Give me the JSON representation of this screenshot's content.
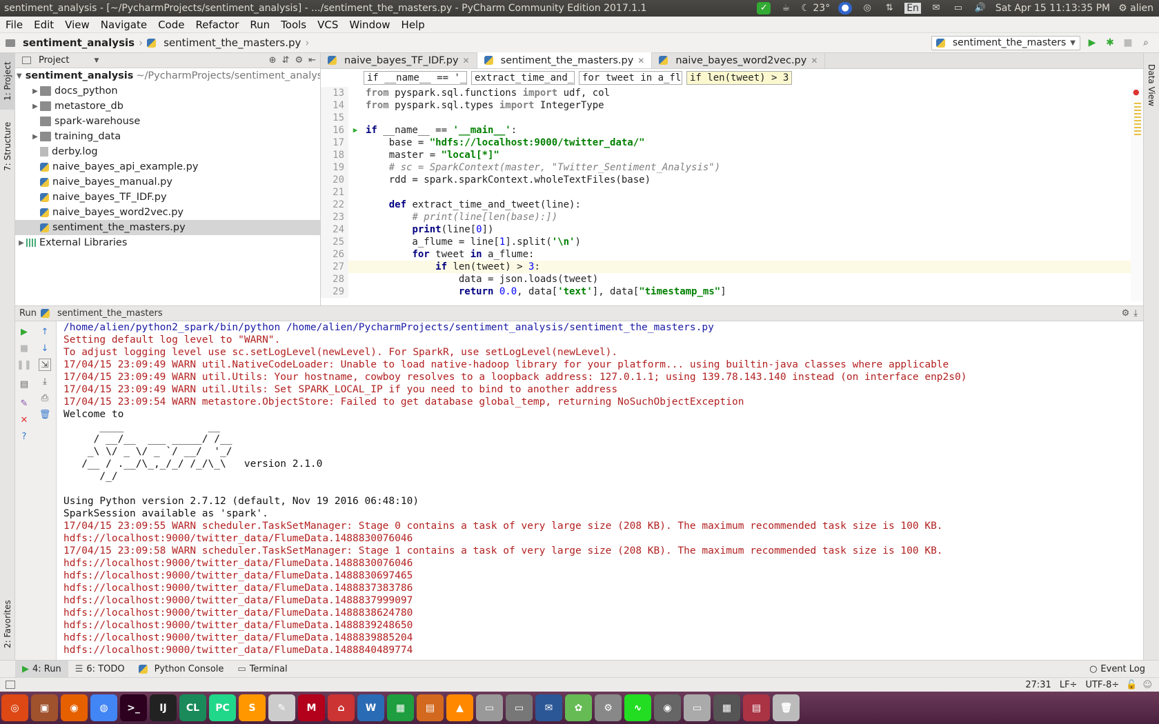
{
  "window": {
    "title": "sentiment_analysis - [~/PycharmProjects/sentiment_analysis] - .../sentiment_the_masters.py - PyCharm Community Edition 2017.1.1"
  },
  "tray": {
    "temp": "23°",
    "lang": "En",
    "datetime": "Sat Apr 15 11:13:35 PM",
    "user": "alien"
  },
  "menu": [
    "File",
    "Edit",
    "View",
    "Navigate",
    "Code",
    "Refactor",
    "Run",
    "Tools",
    "VCS",
    "Window",
    "Help"
  ],
  "breadcrumb": {
    "project": "sentiment_analysis",
    "file": "sentiment_the_masters.py"
  },
  "run_config": "sentiment_the_masters",
  "sidebar_tabs": {
    "project": "1: Project",
    "structure": "7: Structure",
    "favorites": "2: Favorites",
    "data_view": "Data View"
  },
  "project_pane": {
    "header": "Project",
    "root_name": "sentiment_analysis",
    "root_path": "~/PycharmProjects/sentiment_analysis",
    "items": [
      {
        "label": "docs_python",
        "type": "folder"
      },
      {
        "label": "metastore_db",
        "type": "folder"
      },
      {
        "label": "spark-warehouse",
        "type": "folder"
      },
      {
        "label": "training_data",
        "type": "folder"
      },
      {
        "label": "derby.log",
        "type": "log"
      },
      {
        "label": "naive_bayes_api_example.py",
        "type": "py"
      },
      {
        "label": "naive_bayes_manual.py",
        "type": "py"
      },
      {
        "label": "naive_bayes_TF_IDF.py",
        "type": "py"
      },
      {
        "label": "naive_bayes_word2vec.py",
        "type": "py"
      },
      {
        "label": "sentiment_the_masters.py",
        "type": "py"
      }
    ],
    "external": "External Libraries"
  },
  "editor": {
    "tabs": [
      "naive_bayes_TF_IDF.py",
      "sentiment_the_masters.py",
      "naive_bayes_word2vec.py"
    ],
    "breadcrumbs": [
      "if __name__ == '__main__'",
      "extract_time_and_tweet(line)",
      "for tweet in a_flume",
      "if len(tweet) > 3"
    ],
    "lines": [
      {
        "n": "13",
        "html": "<span class='kw gr'>from</span> pyspark.sql.functions <span class='kw gr'>import</span> udf, col"
      },
      {
        "n": "14",
        "html": "<span class='kw gr'>from</span> pyspark.sql.types <span class='kw gr'>import</span> IntegerType"
      },
      {
        "n": "15",
        "html": ""
      },
      {
        "n": "16",
        "html": "<span class='kw'>if</span> __name__ == <span class='st'>'__main__'</span>:"
      },
      {
        "n": "17",
        "html": "    base = <span class='st'>\"hdfs://localhost:9000/twitter_data/\"</span>"
      },
      {
        "n": "18",
        "html": "    master = <span class='st'>\"local[*]\"</span>"
      },
      {
        "n": "19",
        "html": "    <span class='cm'># sc = SparkContext(master, \"Twitter_Sentiment_Analysis\")</span>"
      },
      {
        "n": "20",
        "html": "    rdd = spark.sparkContext.wholeTextFiles(base)"
      },
      {
        "n": "21",
        "html": ""
      },
      {
        "n": "22",
        "html": "    <span class='kw'>def</span> extract_time_and_tweet(line):"
      },
      {
        "n": "23",
        "html": "        <span class='cm'># print(line[len(base):])</span>"
      },
      {
        "n": "24",
        "html": "        <span class='kw'>print</span>(line[<span class='nm'>0</span>])"
      },
      {
        "n": "25",
        "html": "        a_flume = line[<span class='nm'>1</span>].split(<span class='st'>'\\n'</span>)"
      },
      {
        "n": "26",
        "html": "        <span class='kw'>for</span> tweet <span class='kw'>in</span> a_flume:"
      },
      {
        "n": "27",
        "html": "            <span class='kw'>if</span> len(tweet) > <span class='nm'>3</span>:"
      },
      {
        "n": "28",
        "html": "                data = json.loads(tweet)"
      },
      {
        "n": "29",
        "html": "                <span class='kw'>return</span> <span class='nm'>0.0</span>, data[<span class='st'>'text'</span>], data[<span class='st'>\"timestamp_ms\"</span>]"
      }
    ]
  },
  "run_panel": {
    "title": "Run",
    "config": "sentiment_the_masters",
    "lines": [
      {
        "c": "blue",
        "t": "/home/alien/python2_spark/bin/python /home/alien/PycharmProjects/sentiment_analysis/sentiment_the_masters.py"
      },
      {
        "c": "red",
        "t": "Setting default log level to \"WARN\"."
      },
      {
        "c": "red",
        "t": "To adjust logging level use sc.setLogLevel(newLevel). For SparkR, use setLogLevel(newLevel)."
      },
      {
        "c": "red",
        "t": "17/04/15 23:09:49 WARN util.NativeCodeLoader: Unable to load native-hadoop library for your platform... using builtin-java classes where applicable"
      },
      {
        "c": "red",
        "t": "17/04/15 23:09:49 WARN util.Utils: Your hostname, cowboy resolves to a loopback address: 127.0.1.1; using 139.78.143.140 instead (on interface enp2s0)"
      },
      {
        "c": "red",
        "t": "17/04/15 23:09:49 WARN util.Utils: Set SPARK_LOCAL_IP if you need to bind to another address"
      },
      {
        "c": "red",
        "t": "17/04/15 23:09:54 WARN metastore.ObjectStore: Failed to get database global_temp, returning NoSuchObjectException"
      },
      {
        "c": "blk",
        "t": "Welcome to"
      },
      {
        "c": "blk",
        "t": "      ____              __"
      },
      {
        "c": "blk",
        "t": "     / __/__  ___ _____/ /__"
      },
      {
        "c": "blk",
        "t": "    _\\ \\/ _ \\/ _ `/ __/  '_/"
      },
      {
        "c": "blk",
        "t": "   /__ / .__/\\_,_/_/ /_/\\_\\   version 2.1.0"
      },
      {
        "c": "blk",
        "t": "      /_/"
      },
      {
        "c": "blk",
        "t": ""
      },
      {
        "c": "blk",
        "t": "Using Python version 2.7.12 (default, Nov 19 2016 06:48:10)"
      },
      {
        "c": "blk",
        "t": "SparkSession available as 'spark'."
      },
      {
        "c": "red",
        "t": "17/04/15 23:09:55 WARN scheduler.TaskSetManager: Stage 0 contains a task of very large size (208 KB). The maximum recommended task size is 100 KB."
      },
      {
        "c": "red",
        "t": "hdfs://localhost:9000/twitter_data/FlumeData.1488830076046"
      },
      {
        "c": "red",
        "t": "17/04/15 23:09:58 WARN scheduler.TaskSetManager: Stage 1 contains a task of very large size (208 KB). The maximum recommended task size is 100 KB."
      },
      {
        "c": "red",
        "t": "hdfs://localhost:9000/twitter_data/FlumeData.1488830076046"
      },
      {
        "c": "red",
        "t": "hdfs://localhost:9000/twitter_data/FlumeData.1488830697465"
      },
      {
        "c": "red",
        "t": "hdfs://localhost:9000/twitter_data/FlumeData.1488837383786"
      },
      {
        "c": "red",
        "t": "hdfs://localhost:9000/twitter_data/FlumeData.1488837999097"
      },
      {
        "c": "red",
        "t": "hdfs://localhost:9000/twitter_data/FlumeData.1488838624780"
      },
      {
        "c": "red",
        "t": "hdfs://localhost:9000/twitter_data/FlumeData.1488839248650"
      },
      {
        "c": "red",
        "t": "hdfs://localhost:9000/twitter_data/FlumeData.1488839885204"
      },
      {
        "c": "red",
        "t": "hdfs://localhost:9000/twitter_data/FlumeData.1488840489774"
      }
    ]
  },
  "bottom_tabs": [
    "4: Run",
    "6: TODO",
    "Python Console",
    "Terminal"
  ],
  "event_log": "Event Log",
  "status": {
    "position": "27:31",
    "line_sep": "LF÷",
    "encoding": "UTF-8÷"
  },
  "dock": [
    "ubuntu",
    "files",
    "firefox",
    "chrome",
    "terminal",
    "intellij",
    "clion",
    "pycharm",
    "sublime",
    "gedit",
    "mendeley",
    "pdf",
    "writer",
    "calc",
    "impress",
    "vlc",
    "screenshot",
    "monitor",
    "thunderbird",
    "gimp",
    "settings",
    "sysmon",
    "camera",
    "drive",
    "workspaces",
    "media",
    "trash"
  ]
}
